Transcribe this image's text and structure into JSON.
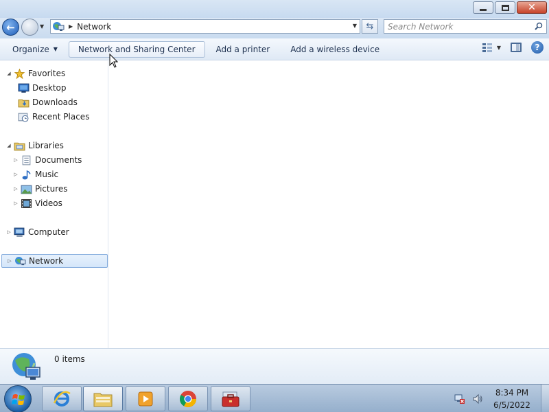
{
  "window": {
    "controls": {
      "minimize_icon": "minimize-icon",
      "maximize_icon": "restore-icon",
      "close_icon": "close-icon"
    }
  },
  "address_bar": {
    "location_icon": "network-icon",
    "path": [
      "Network"
    ],
    "search_placeholder": "Search Network"
  },
  "command_bar": {
    "organize": "Organize",
    "network_sharing": "Network and Sharing Center",
    "add_printer": "Add a printer",
    "add_wireless": "Add a wireless device"
  },
  "nav_pane": {
    "favorites": {
      "label": "Favorites",
      "items": [
        {
          "label": "Desktop",
          "icon": "desktop-icon"
        },
        {
          "label": "Downloads",
          "icon": "downloads-icon"
        },
        {
          "label": "Recent Places",
          "icon": "recent-places-icon"
        }
      ]
    },
    "libraries": {
      "label": "Libraries",
      "items": [
        {
          "label": "Documents",
          "icon": "documents-icon"
        },
        {
          "label": "Music",
          "icon": "music-icon"
        },
        {
          "label": "Pictures",
          "icon": "pictures-icon"
        },
        {
          "label": "Videos",
          "icon": "videos-icon"
        }
      ]
    },
    "computer": {
      "label": "Computer"
    },
    "network": {
      "label": "Network",
      "selected": true
    }
  },
  "details_pane": {
    "item_count": "0 items"
  },
  "taskbar": {
    "apps": [
      "internet-explorer-icon",
      "file-explorer-icon",
      "media-player-icon",
      "chrome-icon",
      "toolbox-icon"
    ],
    "clock_time": "8:34 PM",
    "clock_date": "6/5/2022"
  },
  "colors": {
    "accent": "#1e5cb8",
    "selection": "#d4e6fa",
    "taskbar": "#a7bdd6"
  }
}
